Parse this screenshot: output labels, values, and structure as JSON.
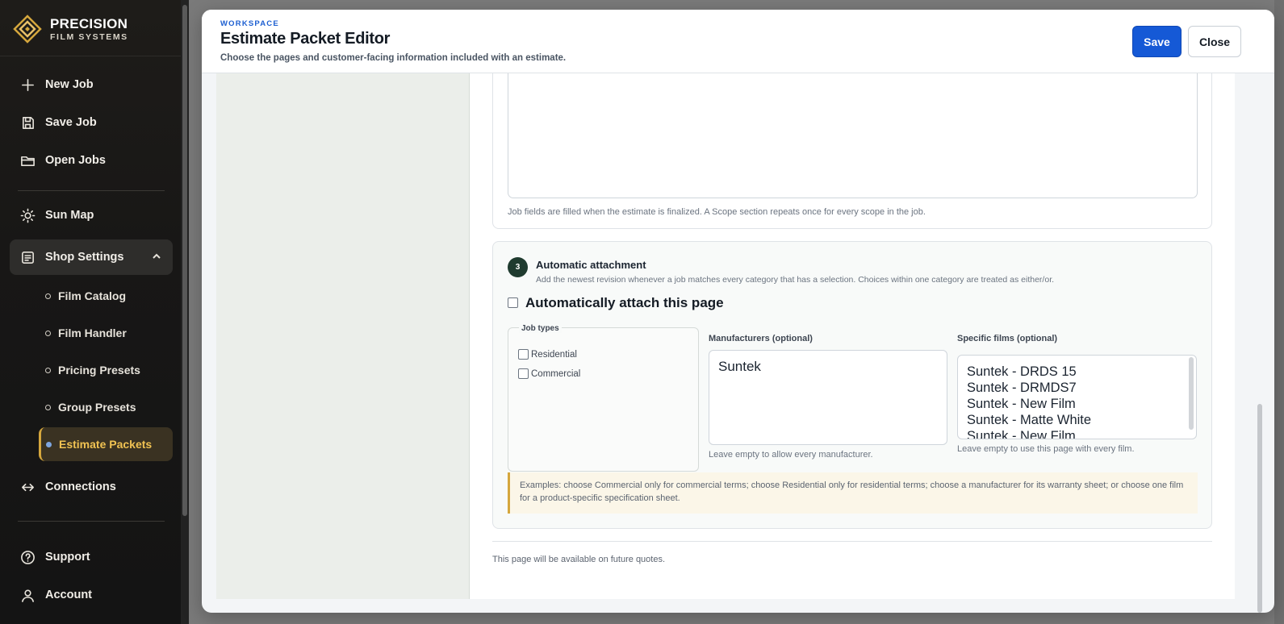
{
  "brand": {
    "name": "PRECISION",
    "sub": "FILM SYSTEMS"
  },
  "sidebar": {
    "nav": [
      {
        "label": "New Job",
        "icon": "plus-icon"
      },
      {
        "label": "Save Job",
        "icon": "save-icon"
      },
      {
        "label": "Open Jobs",
        "icon": "folder-icon"
      },
      {
        "label": "Sun Map",
        "icon": "sun-icon"
      },
      {
        "label": "Shop Settings",
        "icon": "settings-list-icon"
      },
      {
        "label": "Connections",
        "icon": "connections-icon"
      },
      {
        "label": "Support",
        "icon": "help-circle-icon"
      },
      {
        "label": "Account",
        "icon": "user-icon"
      }
    ],
    "sub_items": [
      {
        "label": "Film Catalog"
      },
      {
        "label": "Film Handler"
      },
      {
        "label": "Pricing Presets"
      },
      {
        "label": "Group Presets"
      },
      {
        "label": "Estimate Packets",
        "current": true
      }
    ]
  },
  "modal": {
    "eyebrow": "WORKSPACE",
    "title": "Estimate Packet Editor",
    "description": "Choose the pages and customer-facing information included with an estimate.",
    "save_label": "Save",
    "close_label": "Close"
  },
  "content": {
    "fields_note": "Job fields are filled when the estimate is finalized. A Scope section repeats once for every scope in the job.",
    "attachment": {
      "step": "3",
      "title": "Automatic attachment",
      "description": "Add the newest revision whenever a job matches every category that has a selection. Choices within one category are treated as either/or.",
      "checkbox_label": "Automatically attach this page",
      "job_types": {
        "legend": "Job types",
        "options": [
          "Residential",
          "Commercial"
        ]
      },
      "manufacturers": {
        "label": "Manufacturers (optional)",
        "options": [
          "Suntek"
        ],
        "help": "Leave empty to allow every manufacturer."
      },
      "films": {
        "label": "Specific films (optional)",
        "options": [
          "Suntek - DRDS 15",
          "Suntek - DRMDS7",
          "Suntek - New Film",
          "Suntek - Matte White",
          "Suntek - New Film"
        ],
        "help": "Leave empty to use this page with every film."
      },
      "examples": "Examples: choose Commercial only for commercial terms; choose Residential only for residential terms; choose a manufacturer for its warranty sheet; or choose one film for a product-specific specification sheet."
    },
    "footer_note": "This page will be available on future quotes."
  },
  "colors": {
    "accent": "#1559d6",
    "gold": "#d5a73d",
    "step_badge": "#1f3b2f",
    "sidebar_bg": "#181716"
  }
}
